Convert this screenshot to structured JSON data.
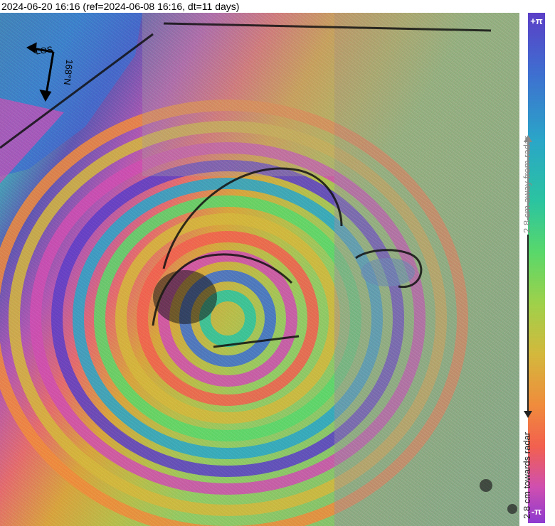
{
  "title": "2024-06-20 16:16 (ref=2024-06-08 16:16, dt=11 days)",
  "map": {
    "los_label": "LOS",
    "azimuth_label": "168°N"
  },
  "colorbar": {
    "top_end": "+π",
    "bottom_end": "-π",
    "away_label": "2.8 cm away from radar",
    "towards_label": "2.8 cm towards radar",
    "colors": [
      "#5b3fc7",
      "#3e6fd0",
      "#2aa6c8",
      "#2bc4a0",
      "#59d86a",
      "#9fd14a",
      "#d4b83c",
      "#f08b3c",
      "#f2604f",
      "#cf4fb0",
      "#8e3ad0"
    ]
  }
}
